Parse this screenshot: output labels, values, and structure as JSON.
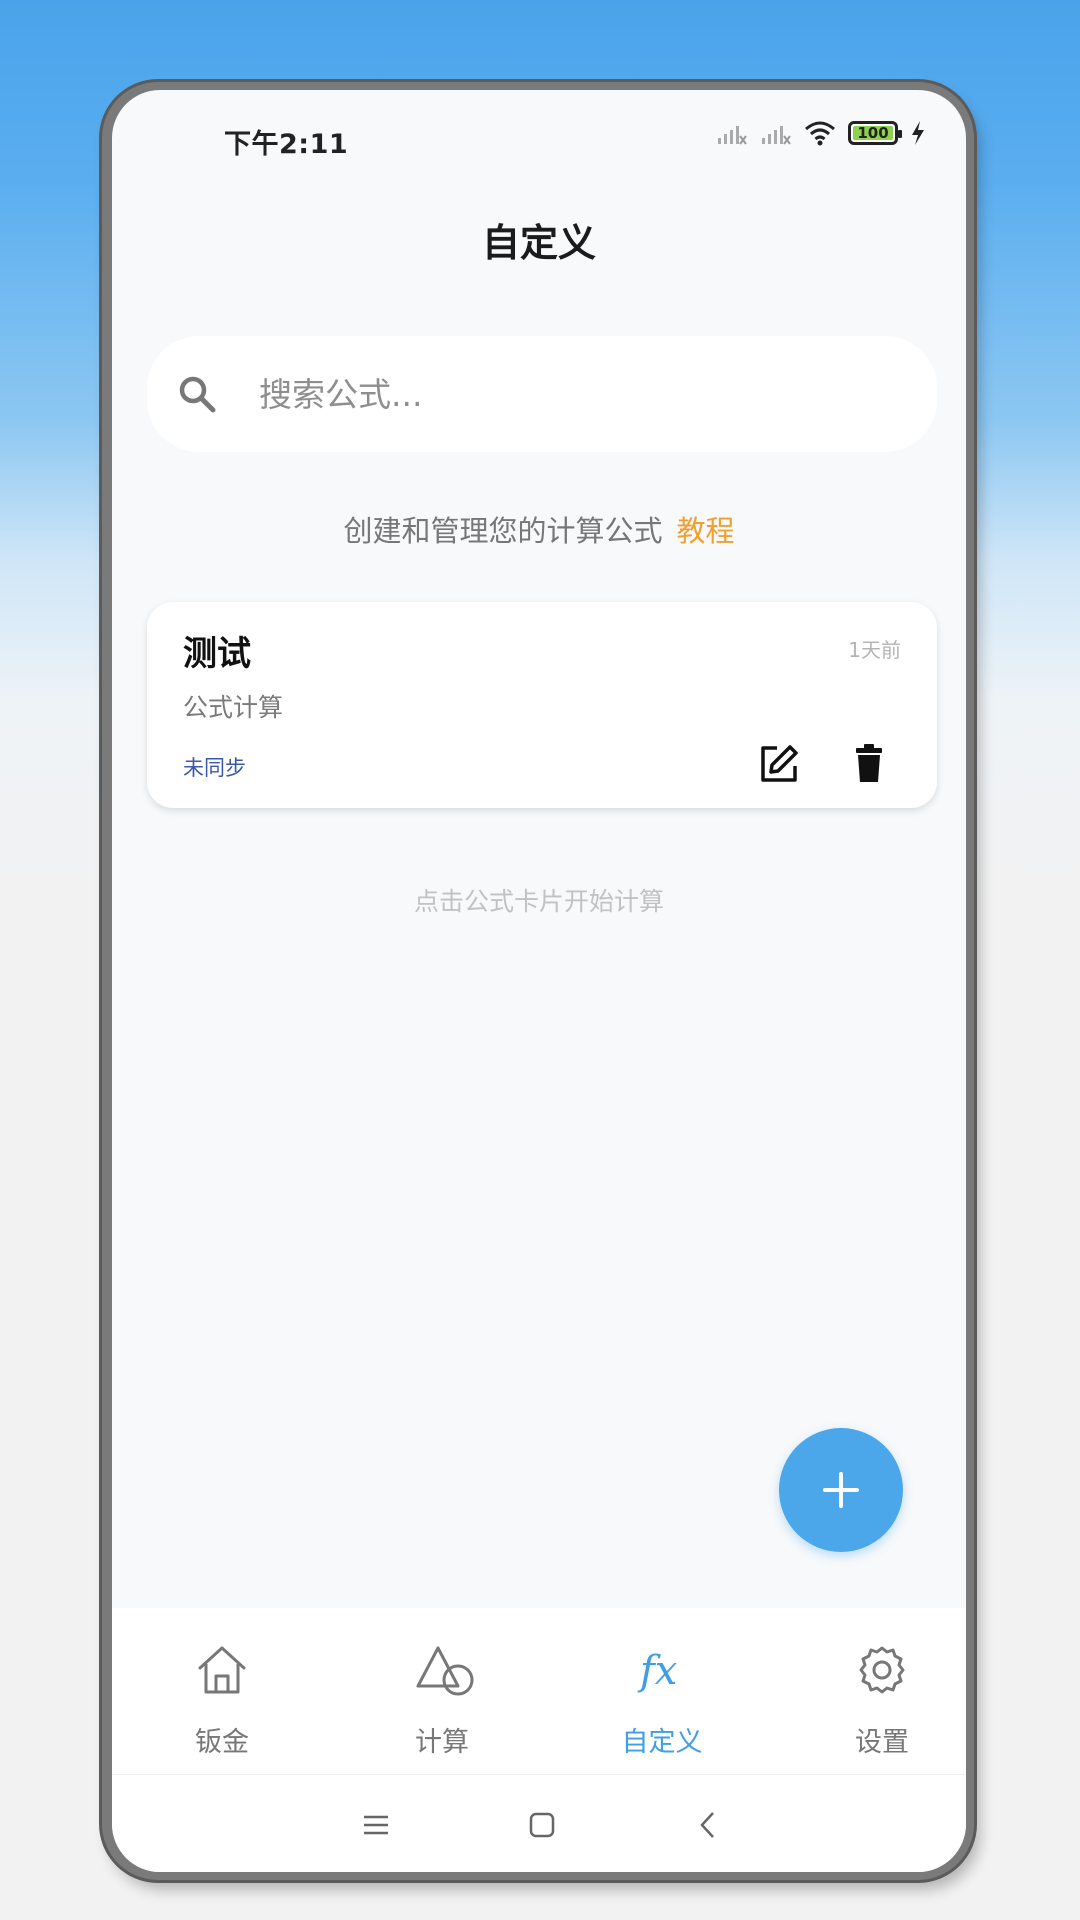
{
  "status_bar": {
    "time": "下午2:11",
    "battery": "100"
  },
  "header": {
    "title": "自定义"
  },
  "search": {
    "placeholder": "搜索公式..."
  },
  "intro": {
    "text": "创建和管理您的计算公式",
    "tutorial_link": "教程"
  },
  "formulas": [
    {
      "title": "测试",
      "time": "1天前",
      "description": "公式计算",
      "sync_status": "未同步"
    }
  ],
  "hint": "点击公式卡片开始计算",
  "bottom_nav": [
    {
      "label": "钣金",
      "icon": "home-icon"
    },
    {
      "label": "计算",
      "icon": "shapes-icon"
    },
    {
      "label": "自定义",
      "icon": "fx-icon",
      "active": true
    },
    {
      "label": "设置",
      "icon": "gear-icon"
    }
  ],
  "colors": {
    "accent": "#4ba6ea",
    "tutorial": "#f0a030",
    "sync": "#3a5aa8"
  }
}
